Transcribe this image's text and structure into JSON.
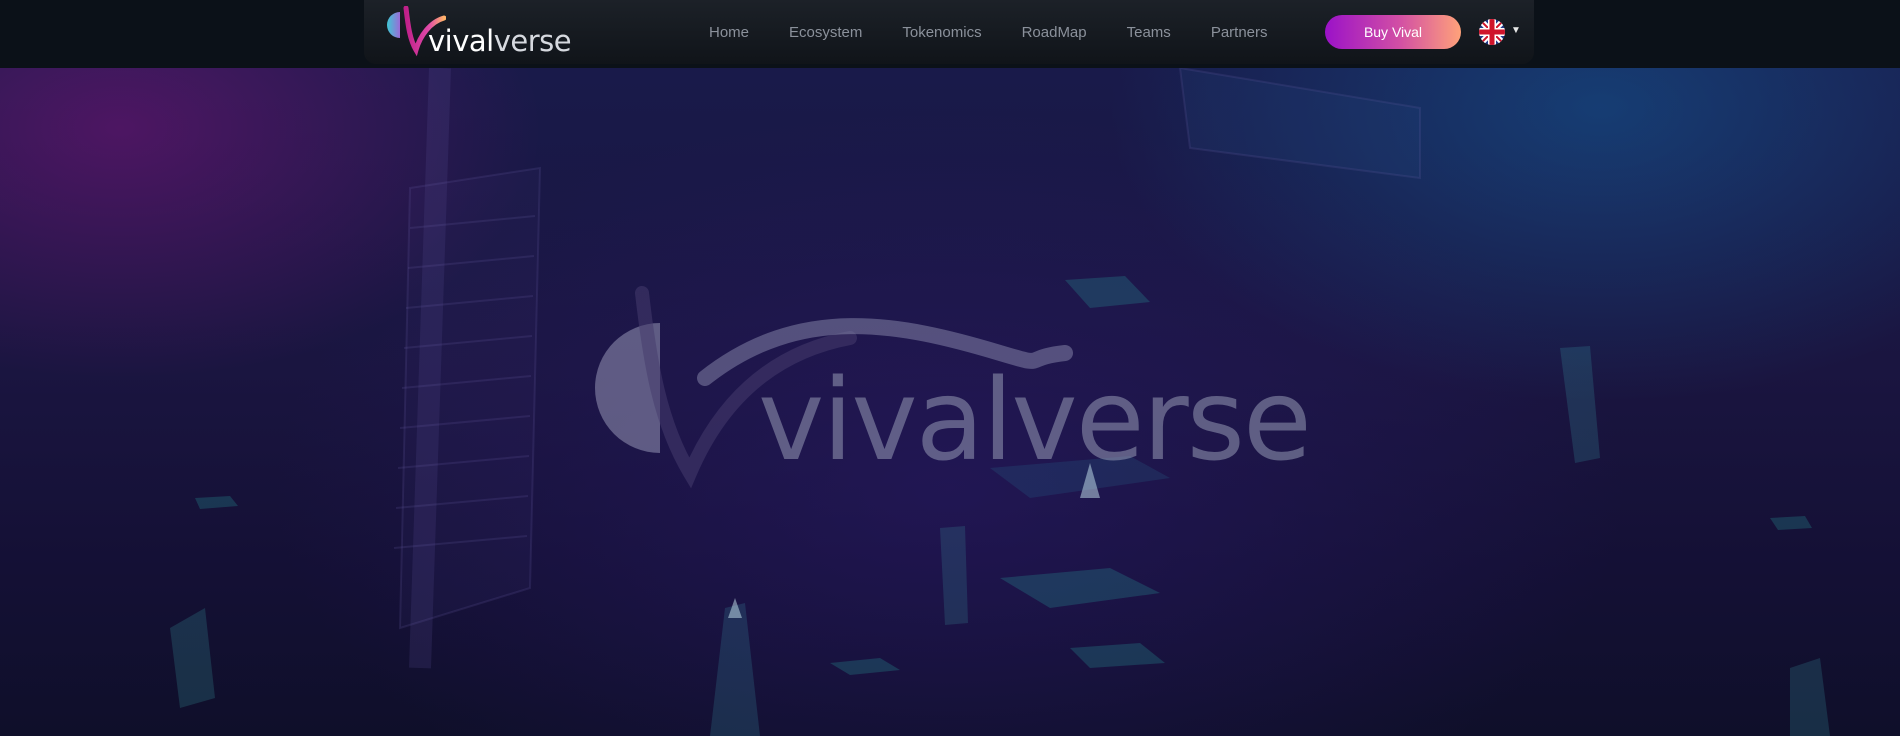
{
  "brand": {
    "name_part1": "vival",
    "name_part2": "verse"
  },
  "nav": {
    "links": [
      "Home",
      "Ecosystem",
      "Tokenomics",
      "RoadMap",
      "Teams",
      "Partners"
    ],
    "buy_label": "Buy Vival",
    "language_icon": "uk-flag-icon",
    "dropdown_icon": "caret-down-icon"
  },
  "hero": {
    "logo_text": "vivalverse"
  },
  "colors": {
    "nav_text": "#8b919b",
    "button_gradient_start": "#9b12c8",
    "button_gradient_end": "#ffa27a",
    "brand_pink": "#e04aa8",
    "brand_cyan": "#3fc7d4"
  }
}
